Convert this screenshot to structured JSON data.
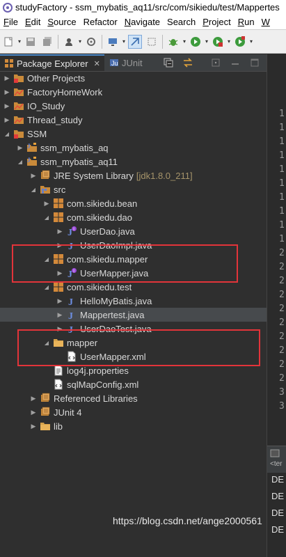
{
  "window": {
    "title": "studyFactory - ssm_mybatis_aq11/src/com/sikiedu/test/Mappertes"
  },
  "menu": [
    {
      "label": "File",
      "u": "F",
      "rest": "ile"
    },
    {
      "label": "Edit",
      "u": "E",
      "rest": "dit"
    },
    {
      "label": "Source",
      "u": "S",
      "rest": "ource"
    },
    {
      "label": "Refactor",
      "u": "",
      "rest": "Refactor"
    },
    {
      "label": "Navigate",
      "u": "N",
      "rest": "avigate"
    },
    {
      "label": "Search",
      "u": "",
      "rest": "Search"
    },
    {
      "label": "Project",
      "u": "P",
      "rest": "roject"
    },
    {
      "label": "Run",
      "u": "R",
      "rest": "un"
    },
    {
      "label": "W",
      "u": "W",
      "rest": ""
    }
  ],
  "view": {
    "active_tab": "Package Explorer",
    "inactive_tab": "JUnit",
    "close_glyph": "✕"
  },
  "tree": [
    {
      "label": "Other Projects",
      "icon": "working-set-icon",
      "twisty": "collapsed",
      "indent": 0
    },
    {
      "label": "FactoryHomeWork",
      "icon": "project-icon",
      "twisty": "collapsed",
      "indent": 0
    },
    {
      "label": "IO_Study",
      "icon": "project-icon",
      "twisty": "collapsed",
      "indent": 0
    },
    {
      "label": "Thread_study",
      "icon": "project-icon",
      "twisty": "collapsed",
      "indent": 0
    },
    {
      "label": "SSM",
      "icon": "working-set-icon",
      "twisty": "expanded",
      "indent": 0
    },
    {
      "label": "ssm_mybatis_aq",
      "icon": "java-project-icon",
      "twisty": "collapsed",
      "indent": 1
    },
    {
      "label": "ssm_mybatis_aq11",
      "icon": "java-project-icon",
      "twisty": "expanded",
      "indent": 1
    },
    {
      "label": "JRE System Library",
      "suffix": "[jdk1.8.0_211]",
      "icon": "library-icon",
      "twisty": "collapsed",
      "indent": 2
    },
    {
      "label": "src",
      "icon": "source-folder-icon",
      "twisty": "expanded",
      "indent": 2
    },
    {
      "label": "com.sikiedu.bean",
      "icon": "package-icon",
      "twisty": "collapsed",
      "indent": 3
    },
    {
      "label": "com.sikiedu.dao",
      "icon": "package-icon",
      "twisty": "expanded",
      "indent": 3
    },
    {
      "label": "UserDao.java",
      "icon": "java-interface-icon",
      "twisty": "collapsed",
      "indent": 4
    },
    {
      "label": "UserDaoImpl.java",
      "icon": "java-file-icon",
      "twisty": "collapsed",
      "indent": 4
    },
    {
      "label": "com.sikiedu.mapper",
      "icon": "package-icon",
      "twisty": "expanded",
      "indent": 3
    },
    {
      "label": "UserMapper.java",
      "icon": "java-interface-icon",
      "twisty": "collapsed",
      "indent": 4
    },
    {
      "label": "com.sikiedu.test",
      "icon": "package-icon",
      "twisty": "expanded",
      "indent": 3
    },
    {
      "label": "HelloMyBatis.java",
      "icon": "java-file-icon",
      "twisty": "collapsed",
      "indent": 4
    },
    {
      "label": "Mappertest.java",
      "icon": "java-file-icon",
      "twisty": "collapsed",
      "indent": 4,
      "selected": true
    },
    {
      "label": "UserDaoTest.java",
      "icon": "java-file-icon",
      "twisty": "collapsed",
      "indent": 4
    },
    {
      "label": "mapper",
      "icon": "folder-icon",
      "twisty": "expanded",
      "indent": 3
    },
    {
      "label": "UserMapper.xml",
      "icon": "xml-file-icon",
      "twisty": "none",
      "indent": 4
    },
    {
      "label": "log4j.properties",
      "icon": "properties-file-icon",
      "twisty": "none",
      "indent": 3
    },
    {
      "label": "sqlMapConfig.xml",
      "icon": "xml-file-icon",
      "twisty": "none",
      "indent": 3
    },
    {
      "label": "Referenced Libraries",
      "icon": "library-icon",
      "twisty": "collapsed",
      "indent": 2
    },
    {
      "label": "JUnit 4",
      "icon": "library-icon",
      "twisty": "collapsed",
      "indent": 2
    },
    {
      "label": "lib",
      "icon": "folder-icon",
      "twisty": "collapsed",
      "indent": 2
    }
  ],
  "editor": {
    "line_number_glyphs": [
      "1",
      "1",
      "1",
      "1",
      "1",
      "1",
      "1",
      "1",
      "1",
      "1",
      "2",
      "2",
      "2",
      "2",
      "2",
      "2",
      "2",
      "2",
      "2",
      "2",
      "3",
      "3"
    ],
    "console_lines": [
      "DE",
      "DE",
      "DE",
      "DE"
    ],
    "console_tab_fragment": "<ter"
  },
  "watermark": "https://blog.csdn.net/ange2000561",
  "colors": {
    "selection": "#474a4d",
    "annotation": "#e3343a",
    "tree_text": "#d9d9d9"
  }
}
